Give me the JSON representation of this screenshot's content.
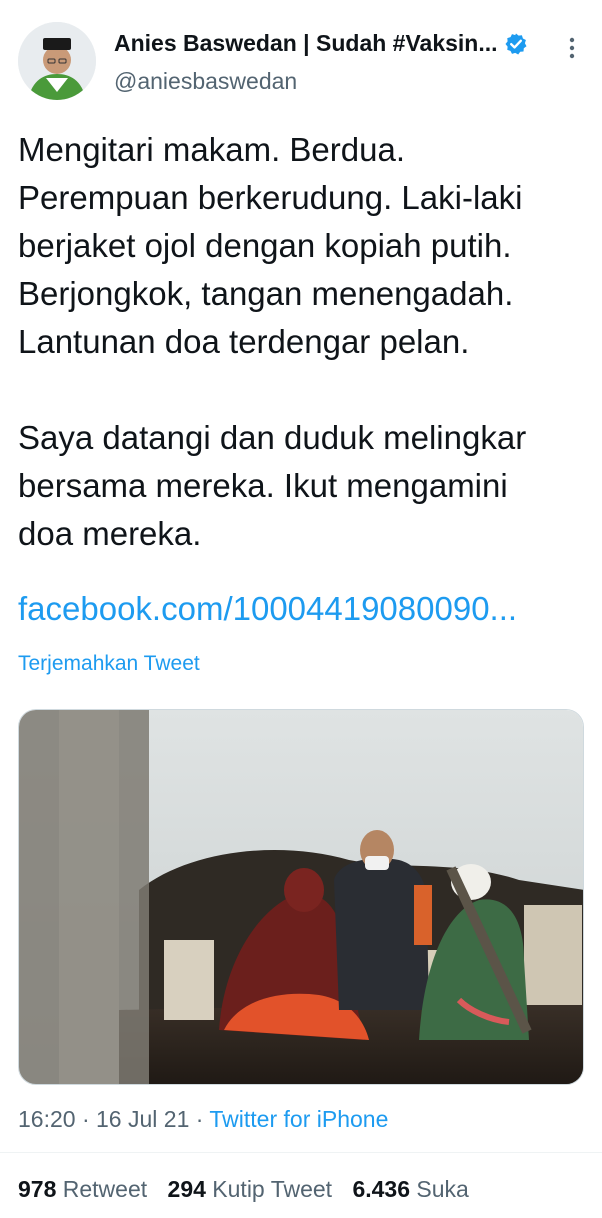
{
  "author": {
    "display_name": "Anies Baswedan | Sudah #Vaksin...",
    "handle": "@aniesbaswedan",
    "avatar_icon": "avatar-photo",
    "verified_icon": "verified-badge-icon",
    "verified_color": "#1d9bf0"
  },
  "tweet": {
    "lines_p1": [
      "Mengitari makam. Berdua.",
      "Perempuan berkerudung. Laki-laki",
      "berjaket ojol dengan kopiah putih.",
      "Berjongkok, tangan menengadah.",
      "Lantunan doa terdengar pelan."
    ],
    "lines_p2": [
      "Saya datangi dan duduk melingkar",
      "bersama mereka. Ikut mengamini",
      "doa mereka."
    ],
    "link": "facebook.com/10004419080090...",
    "translate": "Terjemahkan Tweet"
  },
  "meta": {
    "time": "16:20",
    "sep": " · ",
    "date": "16 Jul 21",
    "source": "Twitter for iPhone"
  },
  "stats": {
    "retweets_count": "978",
    "retweets_label": "Retweet",
    "quotes_count": "294",
    "quotes_label": "Kutip Tweet",
    "likes_count": "6.436",
    "likes_label": "Suka"
  },
  "colors": {
    "link": "#1d9bf0",
    "secondary_text": "#536471",
    "primary_text": "#0f1419"
  }
}
